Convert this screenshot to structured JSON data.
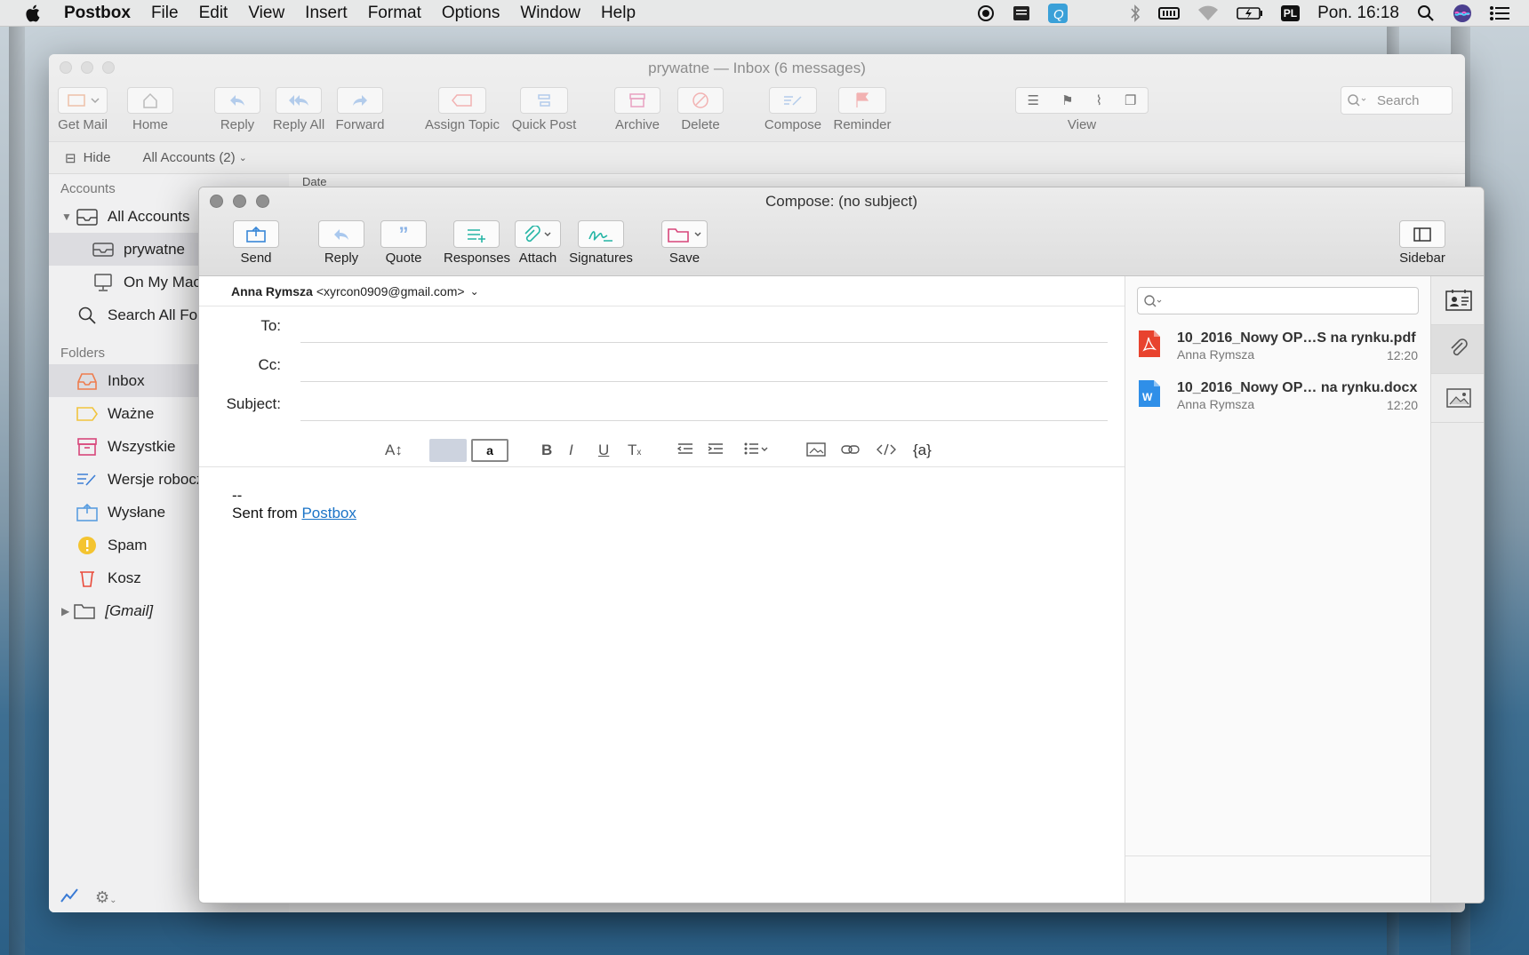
{
  "menubar": {
    "app": "Postbox",
    "items": [
      "File",
      "Edit",
      "View",
      "Insert",
      "Format",
      "Options",
      "Window",
      "Help"
    ],
    "input_source": "PL",
    "clock": "Pon. 16:18"
  },
  "mainwin": {
    "title": "prywatne — Inbox (6 messages)",
    "toolbar": {
      "get_mail": "Get Mail",
      "home": "Home",
      "reply": "Reply",
      "reply_all": "Reply All",
      "forward": "Forward",
      "assign_topic": "Assign Topic",
      "quick_post": "Quick Post",
      "archive": "Archive",
      "delete": "Delete",
      "compose": "Compose",
      "reminder": "Reminder",
      "view": "View",
      "search_placeholder": "Search"
    },
    "subbar": {
      "hide": "Hide",
      "accounts": "All Accounts (2)"
    },
    "column_header": "Date",
    "sidebar": {
      "accounts_header": "Accounts",
      "accounts": [
        "All Accounts",
        "prywatne",
        "On My Mac",
        "Search All Folders"
      ],
      "folders_header": "Folders",
      "folders": [
        "Inbox",
        "Ważne",
        "Wszystkie",
        "Wersje robocze",
        "Wysłane",
        "Spam",
        "Kosz",
        "[Gmail]"
      ]
    }
  },
  "compose": {
    "title": "Compose: (no subject)",
    "toolbar": {
      "send": "Send",
      "reply": "Reply",
      "quote": "Quote",
      "responses": "Responses",
      "attach": "Attach",
      "signatures": "Signatures",
      "save": "Save",
      "sidebar": "Sidebar"
    },
    "from_name": "Anna Rymsza",
    "from_email": "<xyrcon0909@gmail.com>",
    "to_label": "To:",
    "cc_label": "Cc:",
    "subject_label": "Subject:",
    "to_value": "",
    "cc_value": "",
    "subject_value": "",
    "format": {
      "font_size": "A↕",
      "text_color": "a",
      "bold": "B",
      "italic": "I",
      "underline": "U",
      "clear": "T",
      "variables": "{a}"
    },
    "body": {
      "sig_sep": "--",
      "sent_from": "Sent from",
      "link": "Postbox"
    },
    "attachments": [
      {
        "name": "10_2016_Nowy OP…S na rynku.pdf",
        "sender": "Anna Rymsza",
        "time": "12:20",
        "type": "pdf"
      },
      {
        "name": "10_2016_Nowy OP… na rynku.docx",
        "sender": "Anna Rymsza",
        "time": "12:20",
        "type": "docx"
      }
    ]
  },
  "colors": {
    "pdf": "#e8432e",
    "docx": "#2f8fe8",
    "accent_teal": "#25b5a5",
    "link": "#1a73c7"
  }
}
